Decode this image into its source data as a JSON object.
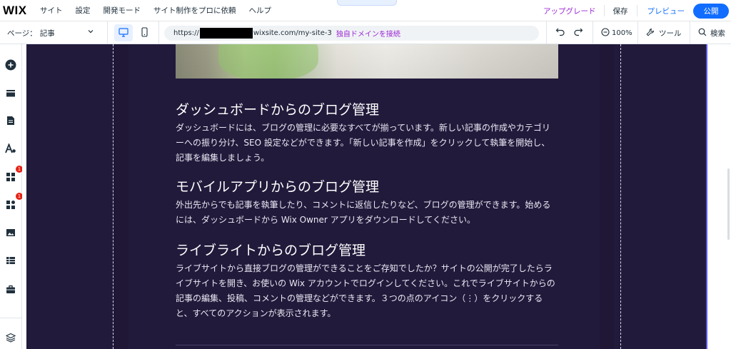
{
  "topbar": {
    "logo": "WIX",
    "menu": [
      "サイト",
      "設定",
      "開発モード",
      "サイト制作をプロに依頼",
      "ヘルプ"
    ],
    "collapse_glyph": "⌃",
    "upgrade": "アップグレード",
    "save": "保存",
    "preview": "プレビュー",
    "publish": "公開"
  },
  "toolbar": {
    "page_label": "ページ：",
    "page_name": "記事",
    "url_prefix": "https://",
    "url_suffix": "wixsite.com/my-site-3",
    "connect_domain": "独自ドメインを接続",
    "zoom": "100%",
    "tools": "ツール",
    "search": "検索"
  },
  "sidebar": {
    "icons": [
      "add-elements-icon",
      "sections-icon",
      "pages-icon",
      "design-icon",
      "apps-icon",
      "business-apps-icon",
      "media-icon",
      "cms-icon",
      "portfolio-icon",
      "layers-icon"
    ],
    "badges": {
      "apps": "1",
      "business_apps": "1"
    }
  },
  "article": {
    "sections": [
      {
        "heading": "ダッシュボードからのブログ管理",
        "body": "ダッシュボードには、ブログの管理に必要なすべてが揃っています。新しい記事の作成やカテゴリーへの振り分け、SEO 設定などができます。「新しい記事を作成」をクリックして執筆を開始し、記事を編集しましょう。"
      },
      {
        "heading": "モバイルアプリからのブログ管理",
        "body": "外出先からでも記事を執筆したり、コメントに返信したりなど、ブログの管理ができます。始めるには、ダッシュボードから Wix Owner アプリをダウンロードしてください。"
      },
      {
        "heading": "ライブライトからのブログ管理",
        "body": "ライブサイトから直接ブログの管理ができることをご存知でしたか？サイトの公開が完了したらライブサイトを開き、お使いの Wix アカウントでログインしてください。これでライブサイトからの記事の編集、投稿、コメントの管理などができます。３つの点のアイコン（⋮）をクリックすると、すべてのアクションが表示されます。"
      }
    ]
  },
  "colors": {
    "accent_blue": "#116dff",
    "upgrade_purple": "#9a27d5",
    "site_background": "#221a3b",
    "badge_red": "#e62214"
  }
}
